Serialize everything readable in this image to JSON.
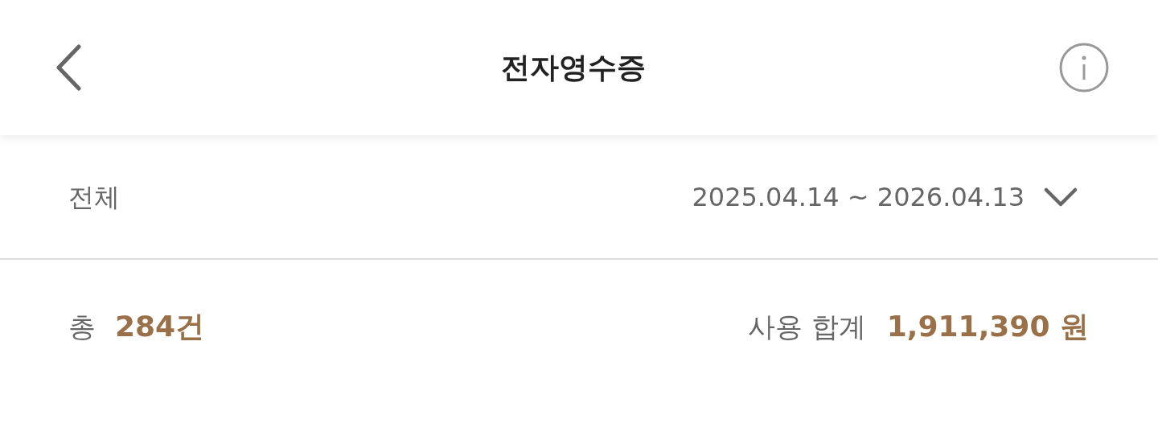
{
  "header": {
    "title": "전자영수증"
  },
  "filter": {
    "category": "전체",
    "date_range": "2025.04.14 ~ 2026.04.13"
  },
  "summary": {
    "count_label": "총",
    "count": "284건",
    "total_label": "사용 합계",
    "total": "1,911,390 원"
  }
}
